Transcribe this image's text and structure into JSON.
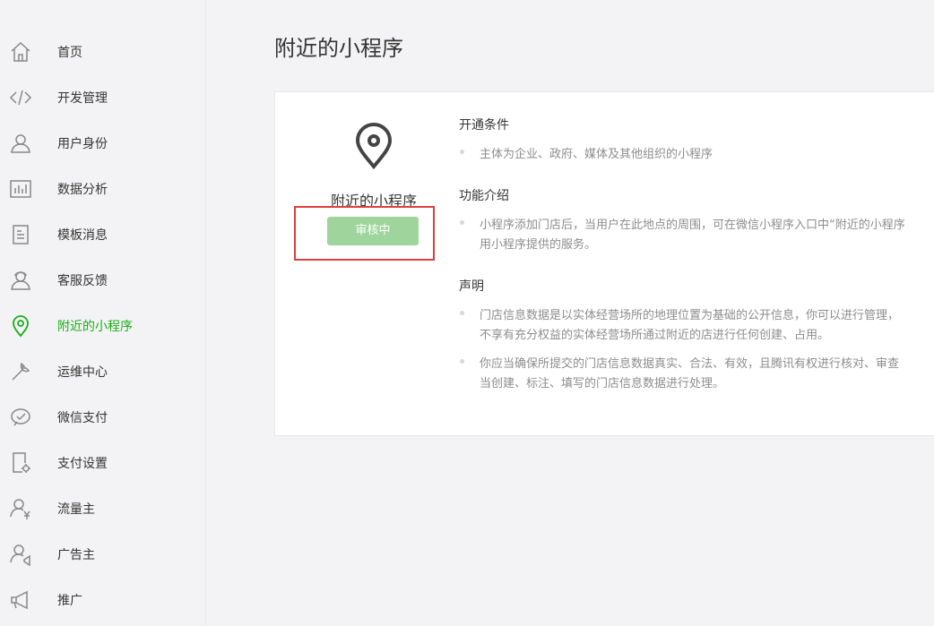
{
  "sidebar": {
    "items": [
      {
        "label": "首页",
        "icon": "home-icon"
      },
      {
        "label": "开发管理",
        "icon": "code-icon"
      },
      {
        "label": "用户身份",
        "icon": "user-icon"
      },
      {
        "label": "数据分析",
        "icon": "chart-icon"
      },
      {
        "label": "模板消息",
        "icon": "document-icon"
      },
      {
        "label": "客服反馈",
        "icon": "headset-user-icon"
      },
      {
        "label": "附近的小程序",
        "icon": "location-pin-icon",
        "active": true
      },
      {
        "label": "运维中心",
        "icon": "wrench-icon"
      },
      {
        "label": "微信支付",
        "icon": "wechat-pay-icon"
      },
      {
        "label": "支付设置",
        "icon": "phone-settings-icon"
      },
      {
        "label": "流量主",
        "icon": "user-yen-icon"
      },
      {
        "label": "广告主",
        "icon": "user-megaphone-icon"
      },
      {
        "label": "推广",
        "icon": "megaphone-icon"
      }
    ]
  },
  "page": {
    "title": "附近的小程序"
  },
  "card": {
    "plugin_name": "附近的小程序",
    "status_button": "审核中",
    "sections": {
      "conditions": {
        "title": "开通条件",
        "items": [
          [
            "主体为企业、政府、媒体及其他组织的小程序"
          ]
        ]
      },
      "intro": {
        "title": "功能介绍",
        "items": [
          [
            "小程序添加门店后，当用户在此地点的周围，可在微信小程序入口中“附近的小程序",
            "用小程序提供的服务。"
          ]
        ]
      },
      "statement": {
        "title": "声明",
        "items": [
          [
            "门店信息数据是以实体经营场所的地理位置为基础的公开信息，你可以进行管理，",
            "不享有充分权益的实体经营场所通过附近的店进行任何创建、占用。"
          ],
          [
            "你应当确保所提交的门店信息数据真实、合法、有效，且腾讯有权进行核对、审查",
            "当创建、标注、填写的门店信息数据进行处理。"
          ]
        ]
      }
    }
  },
  "colors": {
    "accent_green": "#1aad19",
    "button_green_disabled": "#9fd59c",
    "highlight_red": "#d9413f",
    "sidebar_bg": "#f3f3f5"
  }
}
